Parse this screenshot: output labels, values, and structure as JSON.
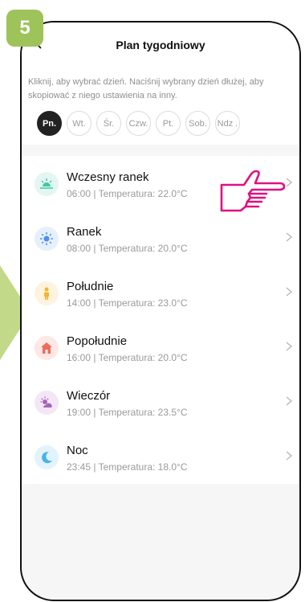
{
  "step": {
    "number": "5"
  },
  "header": {
    "title": "Plan tygodniowy"
  },
  "hint": "Kliknij, aby wybrać dzień. Naciśnij wybrany dzień dłużej, aby skopiować z niego ustawienia na inny.",
  "days": [
    "Pn.",
    "Wt.",
    "Śr.",
    "Czw.",
    "Pt.",
    "Sob.",
    "Ndz ."
  ],
  "active_day_index": 0,
  "schedule": [
    {
      "name": "Wczesny ranek",
      "time": "06:00",
      "separator": "|",
      "temp": "Temperatura: 22.0°C",
      "icon": "sunrise-icon",
      "color": "#3ec8a4"
    },
    {
      "name": "Ranek",
      "time": "08:00",
      "separator": "|",
      "temp": "Temperatura: 20.0°C",
      "icon": "sun-icon",
      "color": "#4a8ef0"
    },
    {
      "name": "Południe",
      "time": "14:00",
      "separator": "|",
      "temp": "Temperatura: 23.0°C",
      "icon": "person-icon",
      "color": "#f4b330"
    },
    {
      "name": "Popołudnie",
      "time": "16:00",
      "separator": "|",
      "temp": "Temperatura: 20.0°C",
      "icon": "home-icon",
      "color": "#ec6d5e"
    },
    {
      "name": "Wieczór",
      "time": "19:00",
      "separator": "|",
      "temp": "Temperatura: 23.5°C",
      "icon": "sunset-icon",
      "color": "#a664b8"
    },
    {
      "name": "Noc",
      "time": "23:45",
      "separator": "|",
      "temp": "Temperatura: 18.0°C",
      "icon": "moon-icon",
      "color": "#49b3e8"
    }
  ],
  "colors": {
    "step_badge": "#9dc35a",
    "pointer": "#e0117f",
    "active_day": "#222222"
  }
}
